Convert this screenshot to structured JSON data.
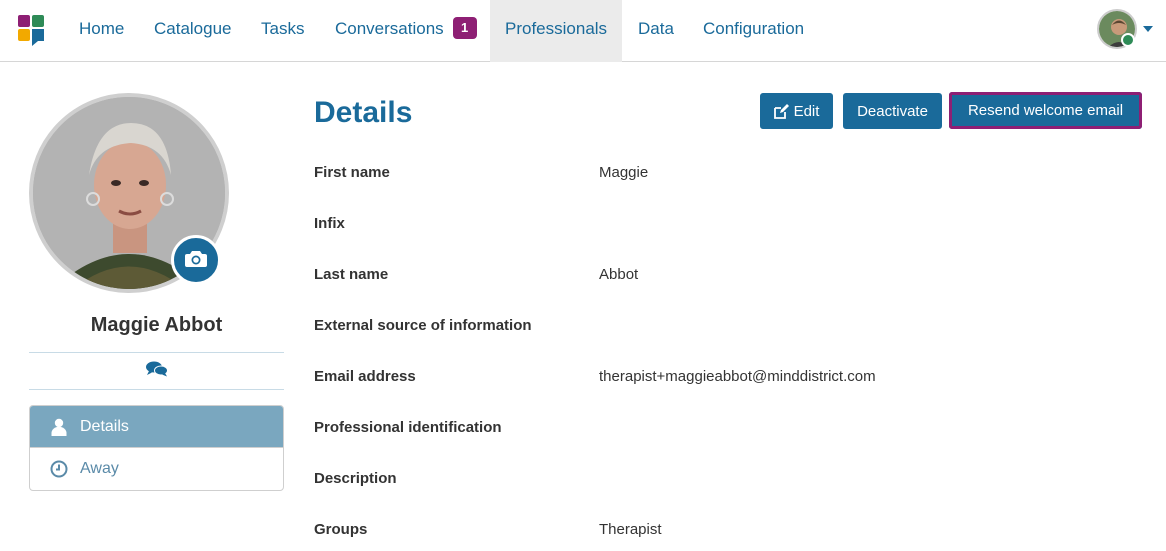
{
  "nav": {
    "items": [
      {
        "label": "Home"
      },
      {
        "label": "Catalogue"
      },
      {
        "label": "Tasks"
      },
      {
        "label": "Conversations",
        "badge": "1"
      },
      {
        "label": "Professionals",
        "active": true
      },
      {
        "label": "Data"
      },
      {
        "label": "Configuration"
      }
    ]
  },
  "profile": {
    "name": "Maggie Abbot",
    "menu": [
      {
        "label": "Details",
        "icon": "user-icon",
        "active": true
      },
      {
        "label": "Away",
        "icon": "clock-icon"
      }
    ]
  },
  "main": {
    "title": "Details",
    "buttons": {
      "edit": "Edit",
      "deactivate": "Deactivate",
      "resend": "Resend welcome email"
    },
    "fields": [
      {
        "label": "First name",
        "value": "Maggie"
      },
      {
        "label": "Infix",
        "value": ""
      },
      {
        "label": "Last name",
        "value": "Abbot"
      },
      {
        "label": "External source of information",
        "value": ""
      },
      {
        "label": "Email address",
        "value": "therapist+maggieabbot@minddistrict.com"
      },
      {
        "label": "Professional identification",
        "value": ""
      },
      {
        "label": "Description",
        "value": ""
      },
      {
        "label": "Groups",
        "value": "Therapist"
      }
    ]
  },
  "colors": {
    "brand_blue": "#1a6a9a",
    "accent_purple": "#8e1f74",
    "active_menu": "#7aa7bf"
  }
}
